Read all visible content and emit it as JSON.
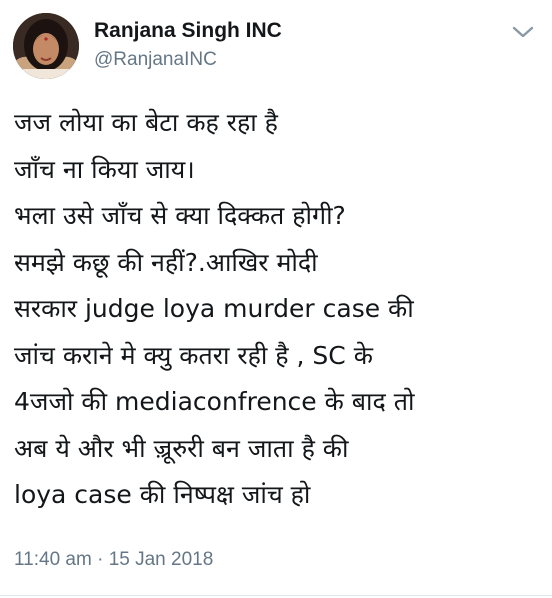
{
  "author": {
    "display_name": "Ranjana Singh INC",
    "handle": "@RanjanaINC",
    "avatar_icon": "profile-photo"
  },
  "menu": {
    "icon": "chevron-down-icon"
  },
  "tweet": {
    "lines": [
      "जज लोया का बेटा कह रहा है",
      "जाँच ना किया जाय।",
      "भला उसे जाँच से क्या दिक्कत होगी?",
      "समझे कछू की नहीं?.आखिर मोदी",
      "सरकार judge loya murder case की",
      "जांच  कराने  मे क्यु कतरा रही है , SC के",
      "4जजो की mediaconfrence के बाद तो",
      "अब ये और भी ज़्रूरुरी बन जाता है की",
      "loya case  की निष्पक्ष जांच हो"
    ],
    "timestamp": "11:40 am · 15 Jan 2018"
  },
  "colors": {
    "text": "#14171a",
    "secondary": "#657786",
    "divider": "#e1e8ed"
  }
}
